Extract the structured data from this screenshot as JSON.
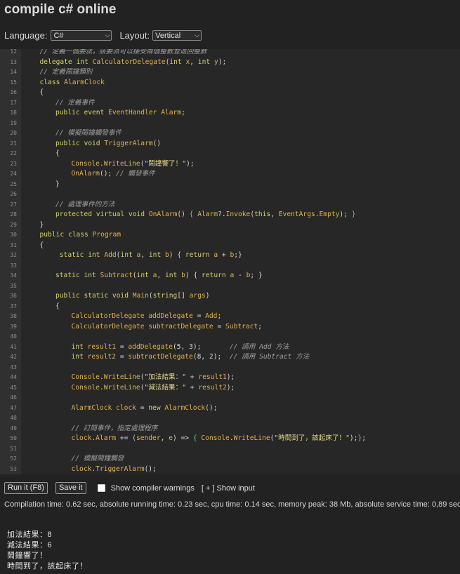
{
  "page": {
    "title": "compile c# online"
  },
  "settings": {
    "language_label": "Language:",
    "language_value": "C#",
    "layout_label": "Layout:",
    "layout_value": "Vertical"
  },
  "editor": {
    "colors": {
      "comment": "#a0a0a0",
      "keyword": "#d7d26a",
      "identifier": "#e2b24e",
      "string": "#e6dc87",
      "plain": "#d6d6d6",
      "brace": "#d6d6d6",
      "green": "#5fd36a"
    },
    "lines": [
      {
        "n": "12",
        "indent": 1,
        "tokens": [
          [
            "c",
            "// 定義一個委派，該委派可以接受兩個整數並返回整數"
          ]
        ]
      },
      {
        "n": "13",
        "indent": 1,
        "tokens": [
          [
            "k",
            "delegate "
          ],
          [
            "k",
            "int "
          ],
          [
            "i",
            "CalculatorDelegate"
          ],
          [
            "p",
            "("
          ],
          [
            "k",
            "int "
          ],
          [
            "i",
            "x"
          ],
          [
            "p",
            ", "
          ],
          [
            "k",
            "int "
          ],
          [
            "i",
            "y"
          ],
          [
            "p",
            ");"
          ]
        ]
      },
      {
        "n": "14",
        "indent": 1,
        "tokens": [
          [
            "c",
            "// 定義鬧鐘類別"
          ]
        ]
      },
      {
        "n": "15",
        "indent": 1,
        "tokens": [
          [
            "k",
            "class "
          ],
          [
            "i",
            "AlarmClock"
          ]
        ]
      },
      {
        "n": "16",
        "indent": 1,
        "tokens": [
          [
            "b",
            "{"
          ]
        ]
      },
      {
        "n": "17",
        "indent": 2,
        "tokens": [
          [
            "c",
            "// 定義事件"
          ]
        ]
      },
      {
        "n": "18",
        "indent": 2,
        "tokens": [
          [
            "k",
            "public "
          ],
          [
            "k",
            "event "
          ],
          [
            "i",
            "EventHandler "
          ],
          [
            "i",
            "Alarm"
          ],
          [
            "p",
            ";"
          ]
        ]
      },
      {
        "n": "19",
        "indent": 0,
        "tokens": []
      },
      {
        "n": "20",
        "indent": 2,
        "tokens": [
          [
            "c",
            "// 模擬鬧鐘觸發事件"
          ]
        ]
      },
      {
        "n": "21",
        "indent": 2,
        "tokens": [
          [
            "k",
            "public "
          ],
          [
            "k",
            "void "
          ],
          [
            "i",
            "TriggerAlarm"
          ],
          [
            "p",
            "()"
          ]
        ]
      },
      {
        "n": "22",
        "indent": 2,
        "tokens": [
          [
            "b",
            "{"
          ]
        ]
      },
      {
        "n": "23",
        "indent": 3,
        "tokens": [
          [
            "i",
            "Console"
          ],
          [
            "p",
            "."
          ],
          [
            "i",
            "WriteLine"
          ],
          [
            "p",
            "("
          ],
          [
            "s",
            "\"鬧鐘響了！\""
          ],
          [
            "p",
            ");"
          ]
        ]
      },
      {
        "n": "24",
        "indent": 3,
        "tokens": [
          [
            "i",
            "OnAlarm"
          ],
          [
            "p",
            "(); "
          ],
          [
            "c",
            "// 觸發事件"
          ]
        ]
      },
      {
        "n": "25",
        "indent": 2,
        "tokens": [
          [
            "b",
            "}"
          ]
        ]
      },
      {
        "n": "26",
        "indent": 0,
        "tokens": []
      },
      {
        "n": "27",
        "indent": 2,
        "tokens": [
          [
            "c",
            "// 處理事件的方法"
          ]
        ]
      },
      {
        "n": "28",
        "indent": 2,
        "tokens": [
          [
            "k",
            "protected "
          ],
          [
            "k",
            "virtual "
          ],
          [
            "k",
            "void "
          ],
          [
            "i",
            "OnAlarm"
          ],
          [
            "p",
            "() "
          ],
          [
            "g",
            "{ "
          ],
          [
            "i",
            "Alarm"
          ],
          [
            "p",
            "?."
          ],
          [
            "i",
            "Invoke"
          ],
          [
            "p",
            "("
          ],
          [
            "k",
            "this"
          ],
          [
            "p",
            ", "
          ],
          [
            "i",
            "EventArgs"
          ],
          [
            "p",
            "."
          ],
          [
            "i",
            "Empty"
          ],
          [
            "p",
            "); "
          ],
          [
            "g",
            "}"
          ]
        ]
      },
      {
        "n": "29",
        "indent": 1,
        "tokens": [
          [
            "b",
            "}"
          ]
        ]
      },
      {
        "n": "30",
        "indent": 1,
        "tokens": [
          [
            "k",
            "public "
          ],
          [
            "k",
            "class "
          ],
          [
            "i",
            "Program"
          ]
        ]
      },
      {
        "n": "31",
        "indent": 1,
        "tokens": [
          [
            "b",
            "{"
          ]
        ]
      },
      {
        "n": "32",
        "indent": 2,
        "tokens": [
          [
            "p",
            " "
          ],
          [
            "k",
            "static "
          ],
          [
            "k",
            "int "
          ],
          [
            "i",
            "Add"
          ],
          [
            "p",
            "("
          ],
          [
            "k",
            "int "
          ],
          [
            "i",
            "a"
          ],
          [
            "p",
            ", "
          ],
          [
            "k",
            "int "
          ],
          [
            "i",
            "b"
          ],
          [
            "p",
            ") { "
          ],
          [
            "k",
            "return "
          ],
          [
            "i",
            "a "
          ],
          [
            "p",
            "+ "
          ],
          [
            "i",
            "b"
          ],
          [
            "p",
            ";}"
          ]
        ]
      },
      {
        "n": "33",
        "indent": 0,
        "tokens": []
      },
      {
        "n": "34",
        "indent": 2,
        "tokens": [
          [
            "k",
            "static "
          ],
          [
            "k",
            "int "
          ],
          [
            "i",
            "Subtract"
          ],
          [
            "p",
            "("
          ],
          [
            "k",
            "int "
          ],
          [
            "i",
            "a"
          ],
          [
            "p",
            ", "
          ],
          [
            "k",
            "int "
          ],
          [
            "i",
            "b"
          ],
          [
            "p",
            ") { "
          ],
          [
            "k",
            "return "
          ],
          [
            "i",
            "a "
          ],
          [
            "p",
            "- "
          ],
          [
            "i",
            "b"
          ],
          [
            "p",
            "; }"
          ]
        ]
      },
      {
        "n": "35",
        "indent": 0,
        "tokens": []
      },
      {
        "n": "36",
        "indent": 2,
        "tokens": [
          [
            "k",
            "public "
          ],
          [
            "k",
            "static "
          ],
          [
            "k",
            "void "
          ],
          [
            "i",
            "Main"
          ],
          [
            "p",
            "("
          ],
          [
            "k",
            "string"
          ],
          [
            "p",
            "[] "
          ],
          [
            "i",
            "args"
          ],
          [
            "p",
            ")"
          ]
        ]
      },
      {
        "n": "37",
        "indent": 2,
        "tokens": [
          [
            "b",
            "{"
          ]
        ]
      },
      {
        "n": "38",
        "indent": 3,
        "tokens": [
          [
            "i",
            "CalculatorDelegate "
          ],
          [
            "i",
            "addDelegate "
          ],
          [
            "p",
            "= "
          ],
          [
            "i",
            "Add"
          ],
          [
            "p",
            ";"
          ]
        ]
      },
      {
        "n": "39",
        "indent": 3,
        "tokens": [
          [
            "i",
            "CalculatorDelegate "
          ],
          [
            "i",
            "subtractDelegate "
          ],
          [
            "p",
            "= "
          ],
          [
            "i",
            "Subtract"
          ],
          [
            "p",
            ";"
          ]
        ]
      },
      {
        "n": "40",
        "indent": 0,
        "tokens": []
      },
      {
        "n": "41",
        "indent": 3,
        "tokens": [
          [
            "k",
            "int "
          ],
          [
            "i",
            "result1 "
          ],
          [
            "p",
            "= "
          ],
          [
            "i",
            "addDelegate"
          ],
          [
            "p",
            "(5, 3);       "
          ],
          [
            "c",
            "// 調用 Add 方法"
          ]
        ]
      },
      {
        "n": "42",
        "indent": 3,
        "tokens": [
          [
            "k",
            "int "
          ],
          [
            "i",
            "result2 "
          ],
          [
            "p",
            "= "
          ],
          [
            "i",
            "subtractDelegate"
          ],
          [
            "p",
            "(8, 2);  "
          ],
          [
            "c",
            "// 調用 Subtract 方法"
          ]
        ]
      },
      {
        "n": "43",
        "indent": 0,
        "tokens": []
      },
      {
        "n": "44",
        "indent": 3,
        "tokens": [
          [
            "i",
            "Console"
          ],
          [
            "p",
            "."
          ],
          [
            "i",
            "WriteLine"
          ],
          [
            "p",
            "("
          ],
          [
            "s",
            "\"加法結果：\""
          ],
          [
            "p",
            " + "
          ],
          [
            "i",
            "result1"
          ],
          [
            "p",
            ");"
          ]
        ]
      },
      {
        "n": "45",
        "indent": 3,
        "tokens": [
          [
            "i",
            "Console"
          ],
          [
            "p",
            "."
          ],
          [
            "i",
            "WriteLine"
          ],
          [
            "p",
            "("
          ],
          [
            "s",
            "\"減法結果：\""
          ],
          [
            "p",
            " + "
          ],
          [
            "i",
            "result2"
          ],
          [
            "p",
            ");"
          ]
        ]
      },
      {
        "n": "46",
        "indent": 0,
        "tokens": []
      },
      {
        "n": "47",
        "indent": 3,
        "tokens": [
          [
            "i",
            "AlarmClock "
          ],
          [
            "i",
            "clock "
          ],
          [
            "p",
            "= "
          ],
          [
            "k",
            "new "
          ],
          [
            "i",
            "AlarmClock"
          ],
          [
            "p",
            "();"
          ]
        ]
      },
      {
        "n": "48",
        "indent": 0,
        "tokens": []
      },
      {
        "n": "49",
        "indent": 3,
        "tokens": [
          [
            "c",
            "// 訂閱事件，指定處理程序"
          ]
        ]
      },
      {
        "n": "50",
        "indent": 3,
        "tokens": [
          [
            "i",
            "clock"
          ],
          [
            "p",
            "."
          ],
          [
            "i",
            "Alarm "
          ],
          [
            "p",
            "+= ("
          ],
          [
            "i",
            "sender"
          ],
          [
            "p",
            ", "
          ],
          [
            "i",
            "e"
          ],
          [
            "p",
            ") => "
          ],
          [
            "g",
            "{ "
          ],
          [
            "i",
            "Console"
          ],
          [
            "p",
            "."
          ],
          [
            "i",
            "WriteLine"
          ],
          [
            "p",
            "("
          ],
          [
            "s",
            "\"時間到了，該起床了！\""
          ],
          [
            "p",
            ");"
          ],
          [
            "g",
            "}"
          ],
          [
            "p",
            ";"
          ]
        ]
      },
      {
        "n": "51",
        "indent": 0,
        "tokens": []
      },
      {
        "n": "52",
        "indent": 3,
        "tokens": [
          [
            "c",
            "// 模擬鬧鐘觸發"
          ]
        ]
      },
      {
        "n": "53",
        "indent": 3,
        "tokens": [
          [
            "i",
            "clock"
          ],
          [
            "p",
            "."
          ],
          [
            "i",
            "TriggerAlarm"
          ],
          [
            "p",
            "();"
          ]
        ]
      }
    ]
  },
  "toolbar": {
    "run_label": "Run it (F8)",
    "save_label": "Save it",
    "warnings_label": "Show compiler warnings",
    "warnings_checked": false,
    "show_input_label": "[ + ] Show input"
  },
  "stats": {
    "text": "Compilation time: 0.62 sec, absolute running time: 0.23 sec, cpu time: 0.14 sec, memory peak: 38 Mb, absolute service time: 0,89 sec"
  },
  "output": {
    "lines": [
      "加法結果：8",
      "減法結果：6",
      "鬧鐘響了！",
      "時間到了，該起床了！"
    ]
  }
}
